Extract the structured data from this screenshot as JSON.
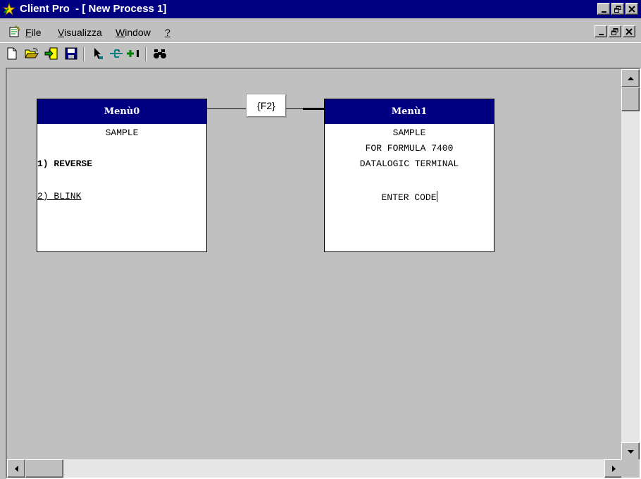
{
  "window": {
    "title": "Client Pro  - [ New Process 1]",
    "title_bar_color": "#000080",
    "minimize_icon": "minimize-icon",
    "maximize_icon": "restore-icon",
    "close_icon": "close-icon"
  },
  "menubar": {
    "items": [
      {
        "label_ul": "F",
        "label_rest": "ile"
      },
      {
        "label_ul": "V",
        "label_rest": "isualizza"
      },
      {
        "label_ul": "W",
        "label_rest": "indow"
      },
      {
        "label_ul": "?",
        "label_rest": ""
      }
    ]
  },
  "toolbar": {
    "buttons": [
      "new-icon",
      "open-icon",
      "exit-icon",
      "save-icon",
      "pointer-icon",
      "link-icon",
      "add-icon",
      "find-icon"
    ]
  },
  "diagram": {
    "menu0": {
      "title": "Menù0",
      "lines": [
        "SAMPLE",
        "1) REVERSE",
        "2) BLINK"
      ]
    },
    "connector_key": "{F2}",
    "menu1": {
      "title": "Menù1",
      "lines": [
        "SAMPLE",
        "FOR FORMULA 7400",
        "DATALOGIC TERMINAL",
        "ENTER CODE"
      ]
    }
  }
}
